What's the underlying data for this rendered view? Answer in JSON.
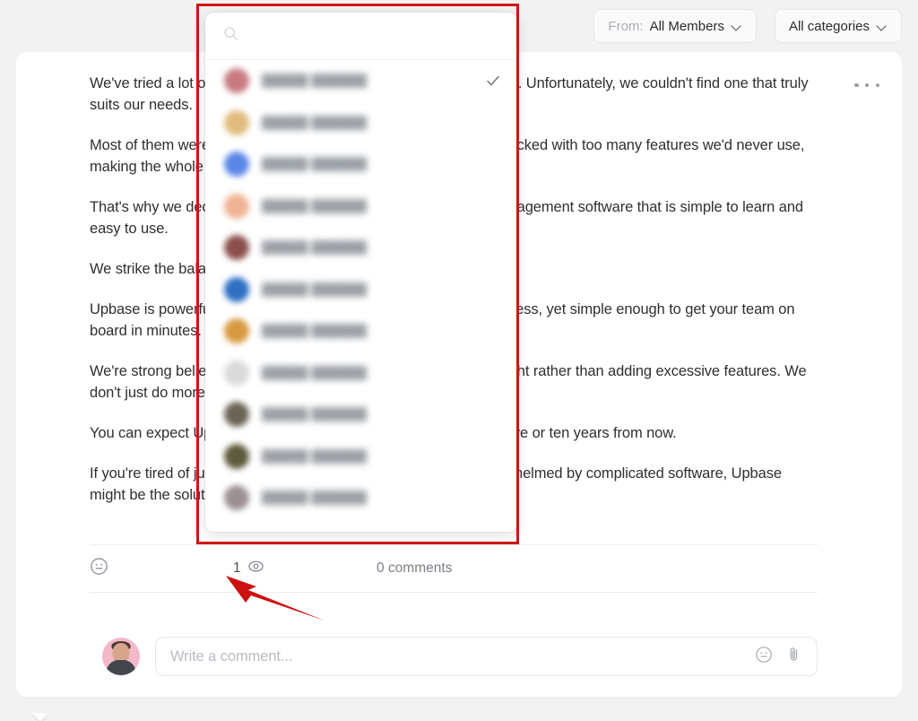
{
  "topbar": {
    "from_filter": {
      "label": "From:",
      "value": "All Members",
      "chevron_icon": "chevron-down-icon"
    },
    "category_filter": {
      "value": "All categories",
      "chevron_icon": "chevron-down-icon"
    }
  },
  "post": {
    "more_icon": "ellipsis-horizontal-icon",
    "paragraphs": [
      "We've tried a lot of project and work management software as well. Unfortunately, we couldn't find one that truly suits our needs.",
      "Most of them were either too simple or too complex. They were packed with too many features we'd never use, making the whole experience feel overwhelming!",
      "That's why we decided to build Upbase — a project and work management software that is simple to learn and easy to use.",
      "We strike the balance between simplicity and functionality.",
      "Upbase is powerful enough to handle the complexity of your business, yet simple enough to get your team on board in minutes.",
      "We're strong believers that it's more important to get the details right rather than adding excessive features. We don't just do more, we do it better.",
      "You can expect Upbase to remain simple and easy to use, even five or ten years from now.",
      "If you're tired of juggling multiple disconnected tools, or feel overwhelmed by complicated software, Upbase might be the solution you're looking for."
    ]
  },
  "meta": {
    "reaction_icon": "smiley-face-icon",
    "views": {
      "count": "1",
      "icon": "eye-icon"
    },
    "comments_label": "0 comments"
  },
  "composer": {
    "avatar": "user-avatar",
    "placeholder": "Write a comment...",
    "emoji_icon": "smiley-face-icon",
    "attach_icon": "paperclip-icon"
  },
  "dropdown": {
    "search": {
      "placeholder": "",
      "value": "",
      "icon": "search-icon"
    },
    "check_icon": "check-icon",
    "members": [
      {
        "name": "",
        "avatar_color": "#c87a80",
        "selected": true
      },
      {
        "name": "",
        "avatar_color": "#e0bb7d",
        "selected": false
      },
      {
        "name": "",
        "avatar_color": "#5b86e8",
        "selected": false
      },
      {
        "name": "",
        "avatar_color": "#f0b393",
        "selected": false
      },
      {
        "name": "",
        "avatar_color": "#8a4f4a",
        "selected": false
      },
      {
        "name": "",
        "avatar_color": "#2f6fc4",
        "selected": false
      },
      {
        "name": "",
        "avatar_color": "#d79a3f",
        "selected": false
      },
      {
        "name": "",
        "avatar_color": "#d9d9d9",
        "selected": false
      },
      {
        "name": "",
        "avatar_color": "#6b6354",
        "selected": false
      },
      {
        "name": "",
        "avatar_color": "#5e5a3c",
        "selected": false
      },
      {
        "name": "",
        "avatar_color": "#9b8f91",
        "selected": false
      }
    ]
  },
  "annotations": {
    "highlight_box": "red-rectangle-highlight",
    "pointer_arrow": "red-arrow-pointing-to-views",
    "color": "#d01414"
  }
}
